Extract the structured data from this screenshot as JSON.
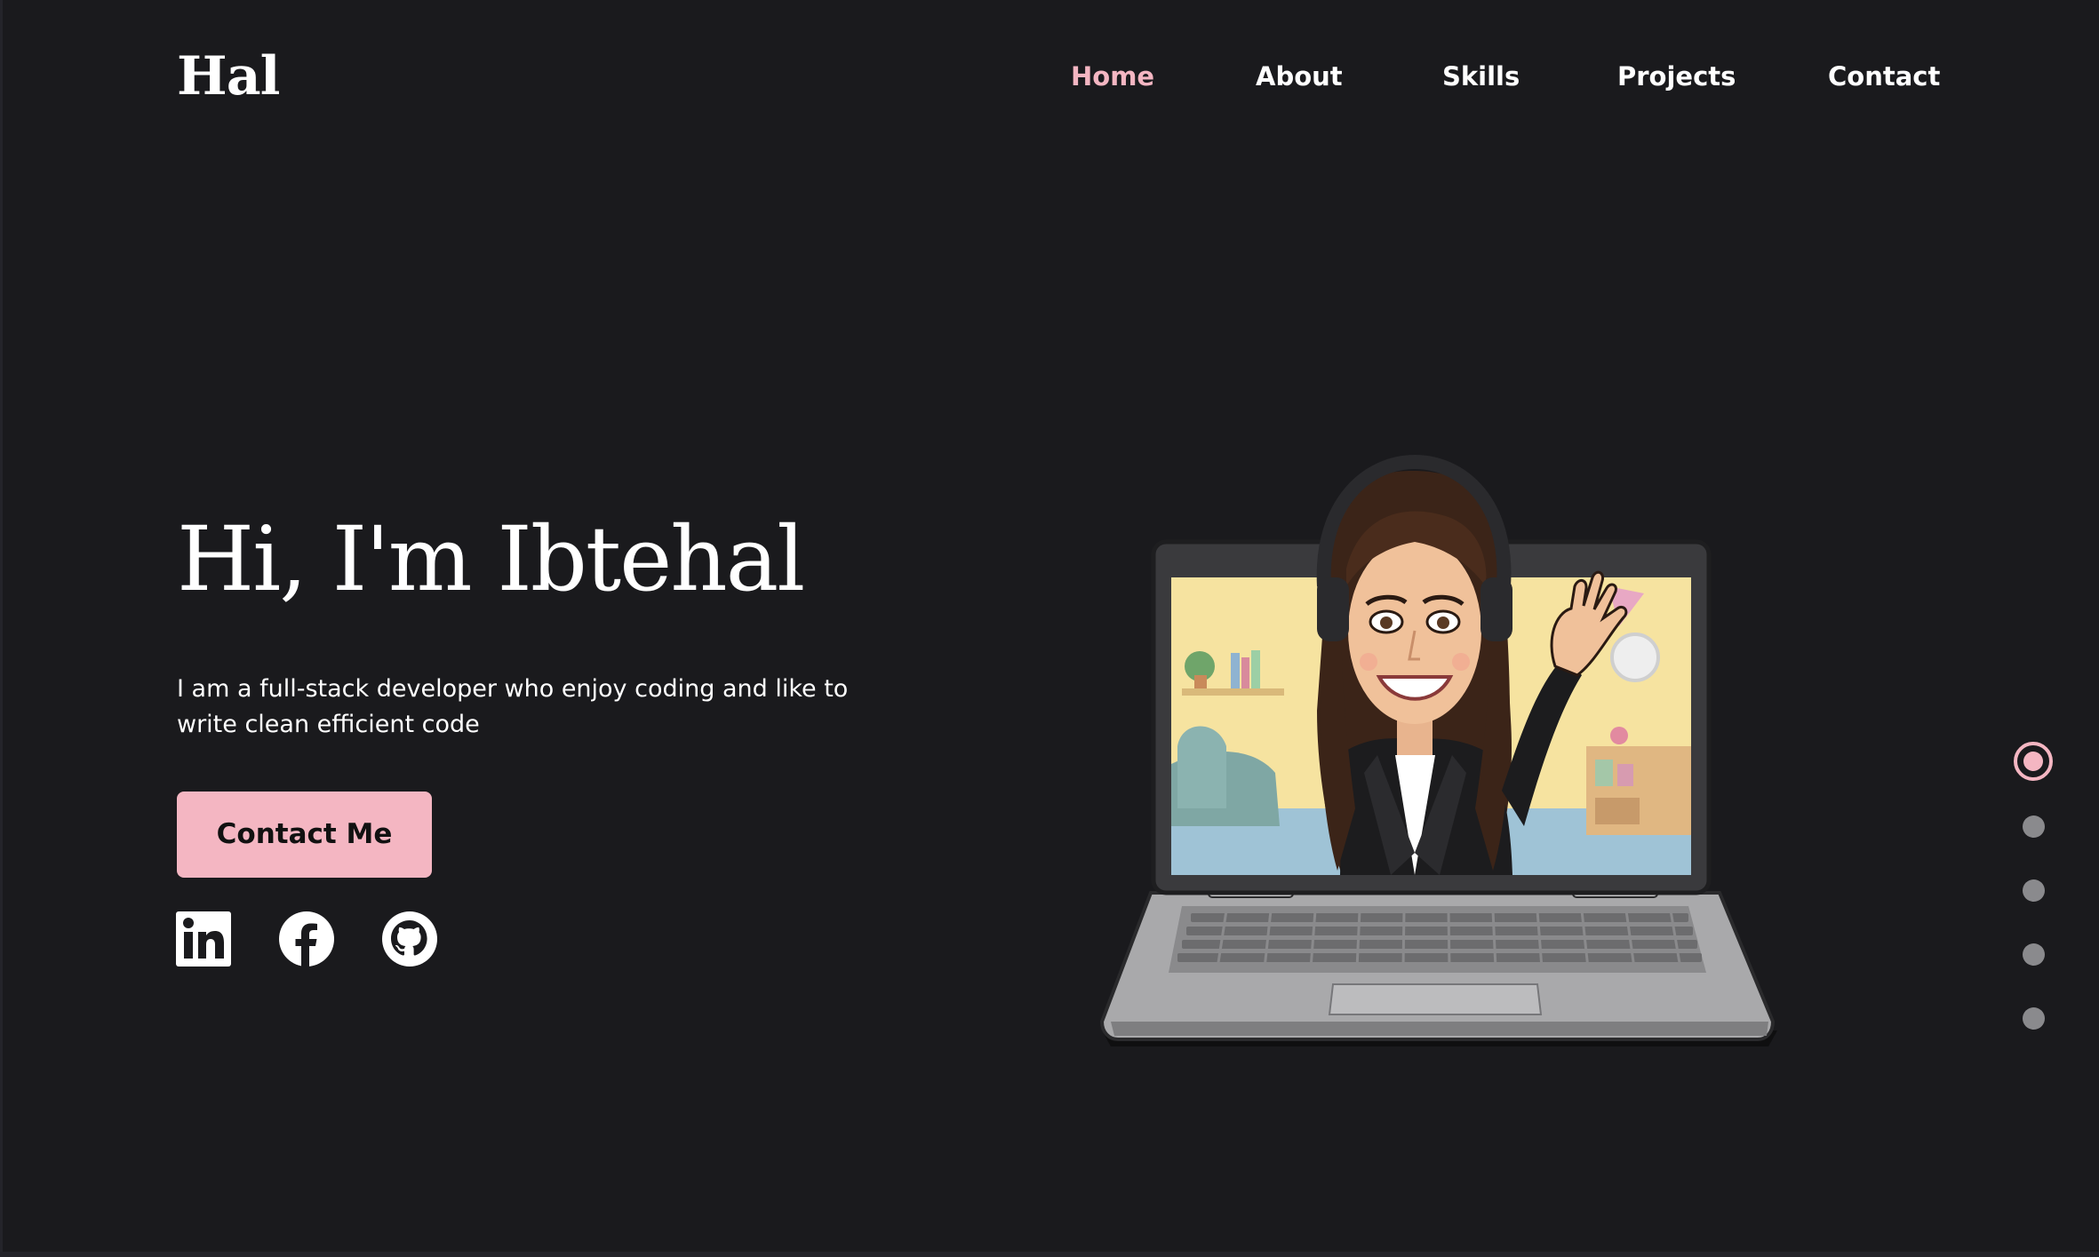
{
  "header": {
    "logo": "Hal",
    "nav": [
      {
        "label": "Home",
        "active": true
      },
      {
        "label": "About",
        "active": false
      },
      {
        "label": "Skills",
        "active": false
      },
      {
        "label": "Projects",
        "active": false
      },
      {
        "label": "Contact",
        "active": false
      }
    ]
  },
  "hero": {
    "title": "Hi, I'm Ibtehal",
    "description": "I am a full-stack developer who enjoy coding and like to write clean efficient code",
    "cta_label": "Contact Me",
    "social": [
      {
        "icon": "linkedin-icon"
      },
      {
        "icon": "facebook-icon"
      },
      {
        "icon": "github-icon"
      }
    ],
    "illustration": "avatar-on-laptop"
  },
  "section_nav": {
    "count": 5,
    "active_index": 0
  },
  "colors": {
    "background": "#1a1a1d",
    "accent": "#f4b6c2",
    "text": "#ffffff",
    "dot_inactive": "#8a8a8d"
  }
}
